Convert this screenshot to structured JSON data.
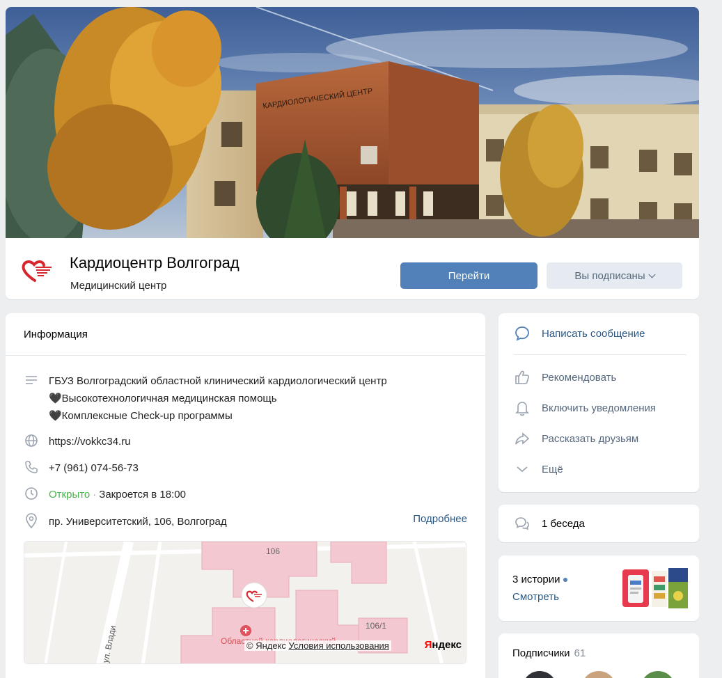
{
  "group": {
    "name": "Кардиоцентр Волгоград",
    "type": "Медицинский центр",
    "cover_text": "КАРДИОЛОГИЧЕСКИЙ ЦЕНТР"
  },
  "buttons": {
    "go": "Перейти",
    "subscribed": "Вы подписаны"
  },
  "info": {
    "title": "Информация",
    "description": [
      "ГБУЗ Волгоградский областной клинический кардиологический центр",
      "🖤Высокотехнологичная медицинская помощь",
      "🖤Комплексные Check-up программы"
    ],
    "website": "https://vokkc34.ru",
    "phone": "+7 (961) 074-56-73",
    "status_open": "Открыто",
    "status_close": "Закроется в 18:00",
    "address": "пр. Университетский, 106, Волгоград",
    "more": "Подробнее"
  },
  "map": {
    "label_106": "106",
    "label_1061": "106/1",
    "street": "ул. Влади",
    "poi": "Областной кардиологический",
    "copyright": "© Яндекс",
    "terms": "Условия использования",
    "brand_y": "Я",
    "brand_rest": "ндекс"
  },
  "actions": [
    {
      "label": "Написать сообщение",
      "icon": "message-icon"
    },
    {
      "label": "Рекомендовать",
      "icon": "thumb-up-icon"
    },
    {
      "label": "Включить уведомления",
      "icon": "bell-icon"
    },
    {
      "label": "Рассказать друзьям",
      "icon": "share-icon"
    },
    {
      "label": "Ещё",
      "icon": "chevron-down-icon"
    }
  ],
  "chats": {
    "label": "1 беседа"
  },
  "stories": {
    "count_label": "3 истории",
    "watch": "Смотреть"
  },
  "subscribers": {
    "label": "Подписчики",
    "count": "61"
  },
  "colors": {
    "accent": "#5181b8",
    "link": "#2a5885",
    "open": "#4bb34b",
    "background": "#edeef0",
    "logo_red": "#d8262e"
  }
}
